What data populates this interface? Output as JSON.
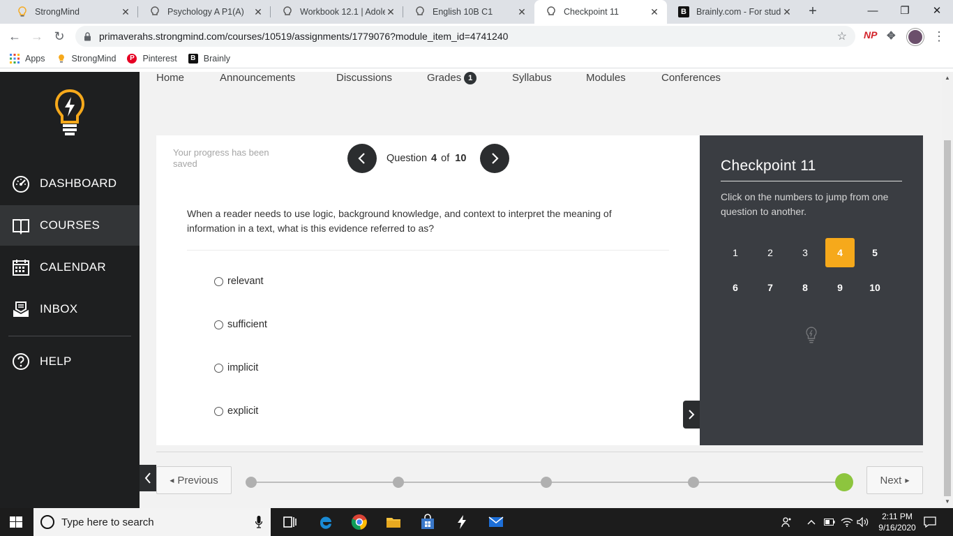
{
  "browser": {
    "tabs": [
      {
        "title": "StrongMind"
      },
      {
        "title": "Psychology A P1(A)"
      },
      {
        "title": "Workbook 12.1 | Adoles"
      },
      {
        "title": "English 10B C1"
      },
      {
        "title": "Checkpoint 11"
      },
      {
        "title": "Brainly.com - For studen"
      }
    ],
    "url": "primaverahs.strongmind.com/courses/10519/assignments/1779076?module_item_id=4741240",
    "bookmarks": [
      {
        "label": "Apps"
      },
      {
        "label": "StrongMind"
      },
      {
        "label": "Pinterest"
      },
      {
        "label": "Brainly"
      }
    ],
    "extension_label": "NP"
  },
  "sidebar": {
    "items": [
      {
        "label": "DASHBOARD"
      },
      {
        "label": "COURSES"
      },
      {
        "label": "CALENDAR"
      },
      {
        "label": "INBOX"
      },
      {
        "label": "HELP"
      }
    ]
  },
  "course_nav": {
    "links": [
      {
        "label": "Home"
      },
      {
        "label": "Announcements"
      },
      {
        "label": "Discussions"
      },
      {
        "label": "Grades",
        "badge": "1"
      },
      {
        "label": "Syllabus"
      },
      {
        "label": "Modules"
      },
      {
        "label": "Conferences"
      }
    ]
  },
  "quiz": {
    "saved_text": "Your progress has been saved",
    "question_word": "Question",
    "current": "4",
    "of_word": "of",
    "total": "10",
    "question_text": "When a reader needs to use logic, background knowledge, and context to interpret the meaning of information in a text, what is this evidence referred to as?",
    "options": [
      "relevant",
      "sufficient",
      "implicit",
      "explicit"
    ]
  },
  "panel": {
    "title": "Checkpoint 11",
    "description": "Click on the numbers to jump from one question to another.",
    "numbers": [
      "1",
      "2",
      "3",
      "4",
      "5",
      "6",
      "7",
      "8",
      "9",
      "10"
    ]
  },
  "footer_nav": {
    "previous_label": "Previous",
    "next_label": "Next"
  },
  "taskbar": {
    "search_placeholder": "Type here to search",
    "time": "2:11 PM",
    "date": "9/16/2020"
  },
  "colors": {
    "accent_orange": "#f6a91b",
    "progress_green": "#8dc53e",
    "sidebar_dark": "#1e1f20",
    "panel_dark": "#3a3d42"
  }
}
